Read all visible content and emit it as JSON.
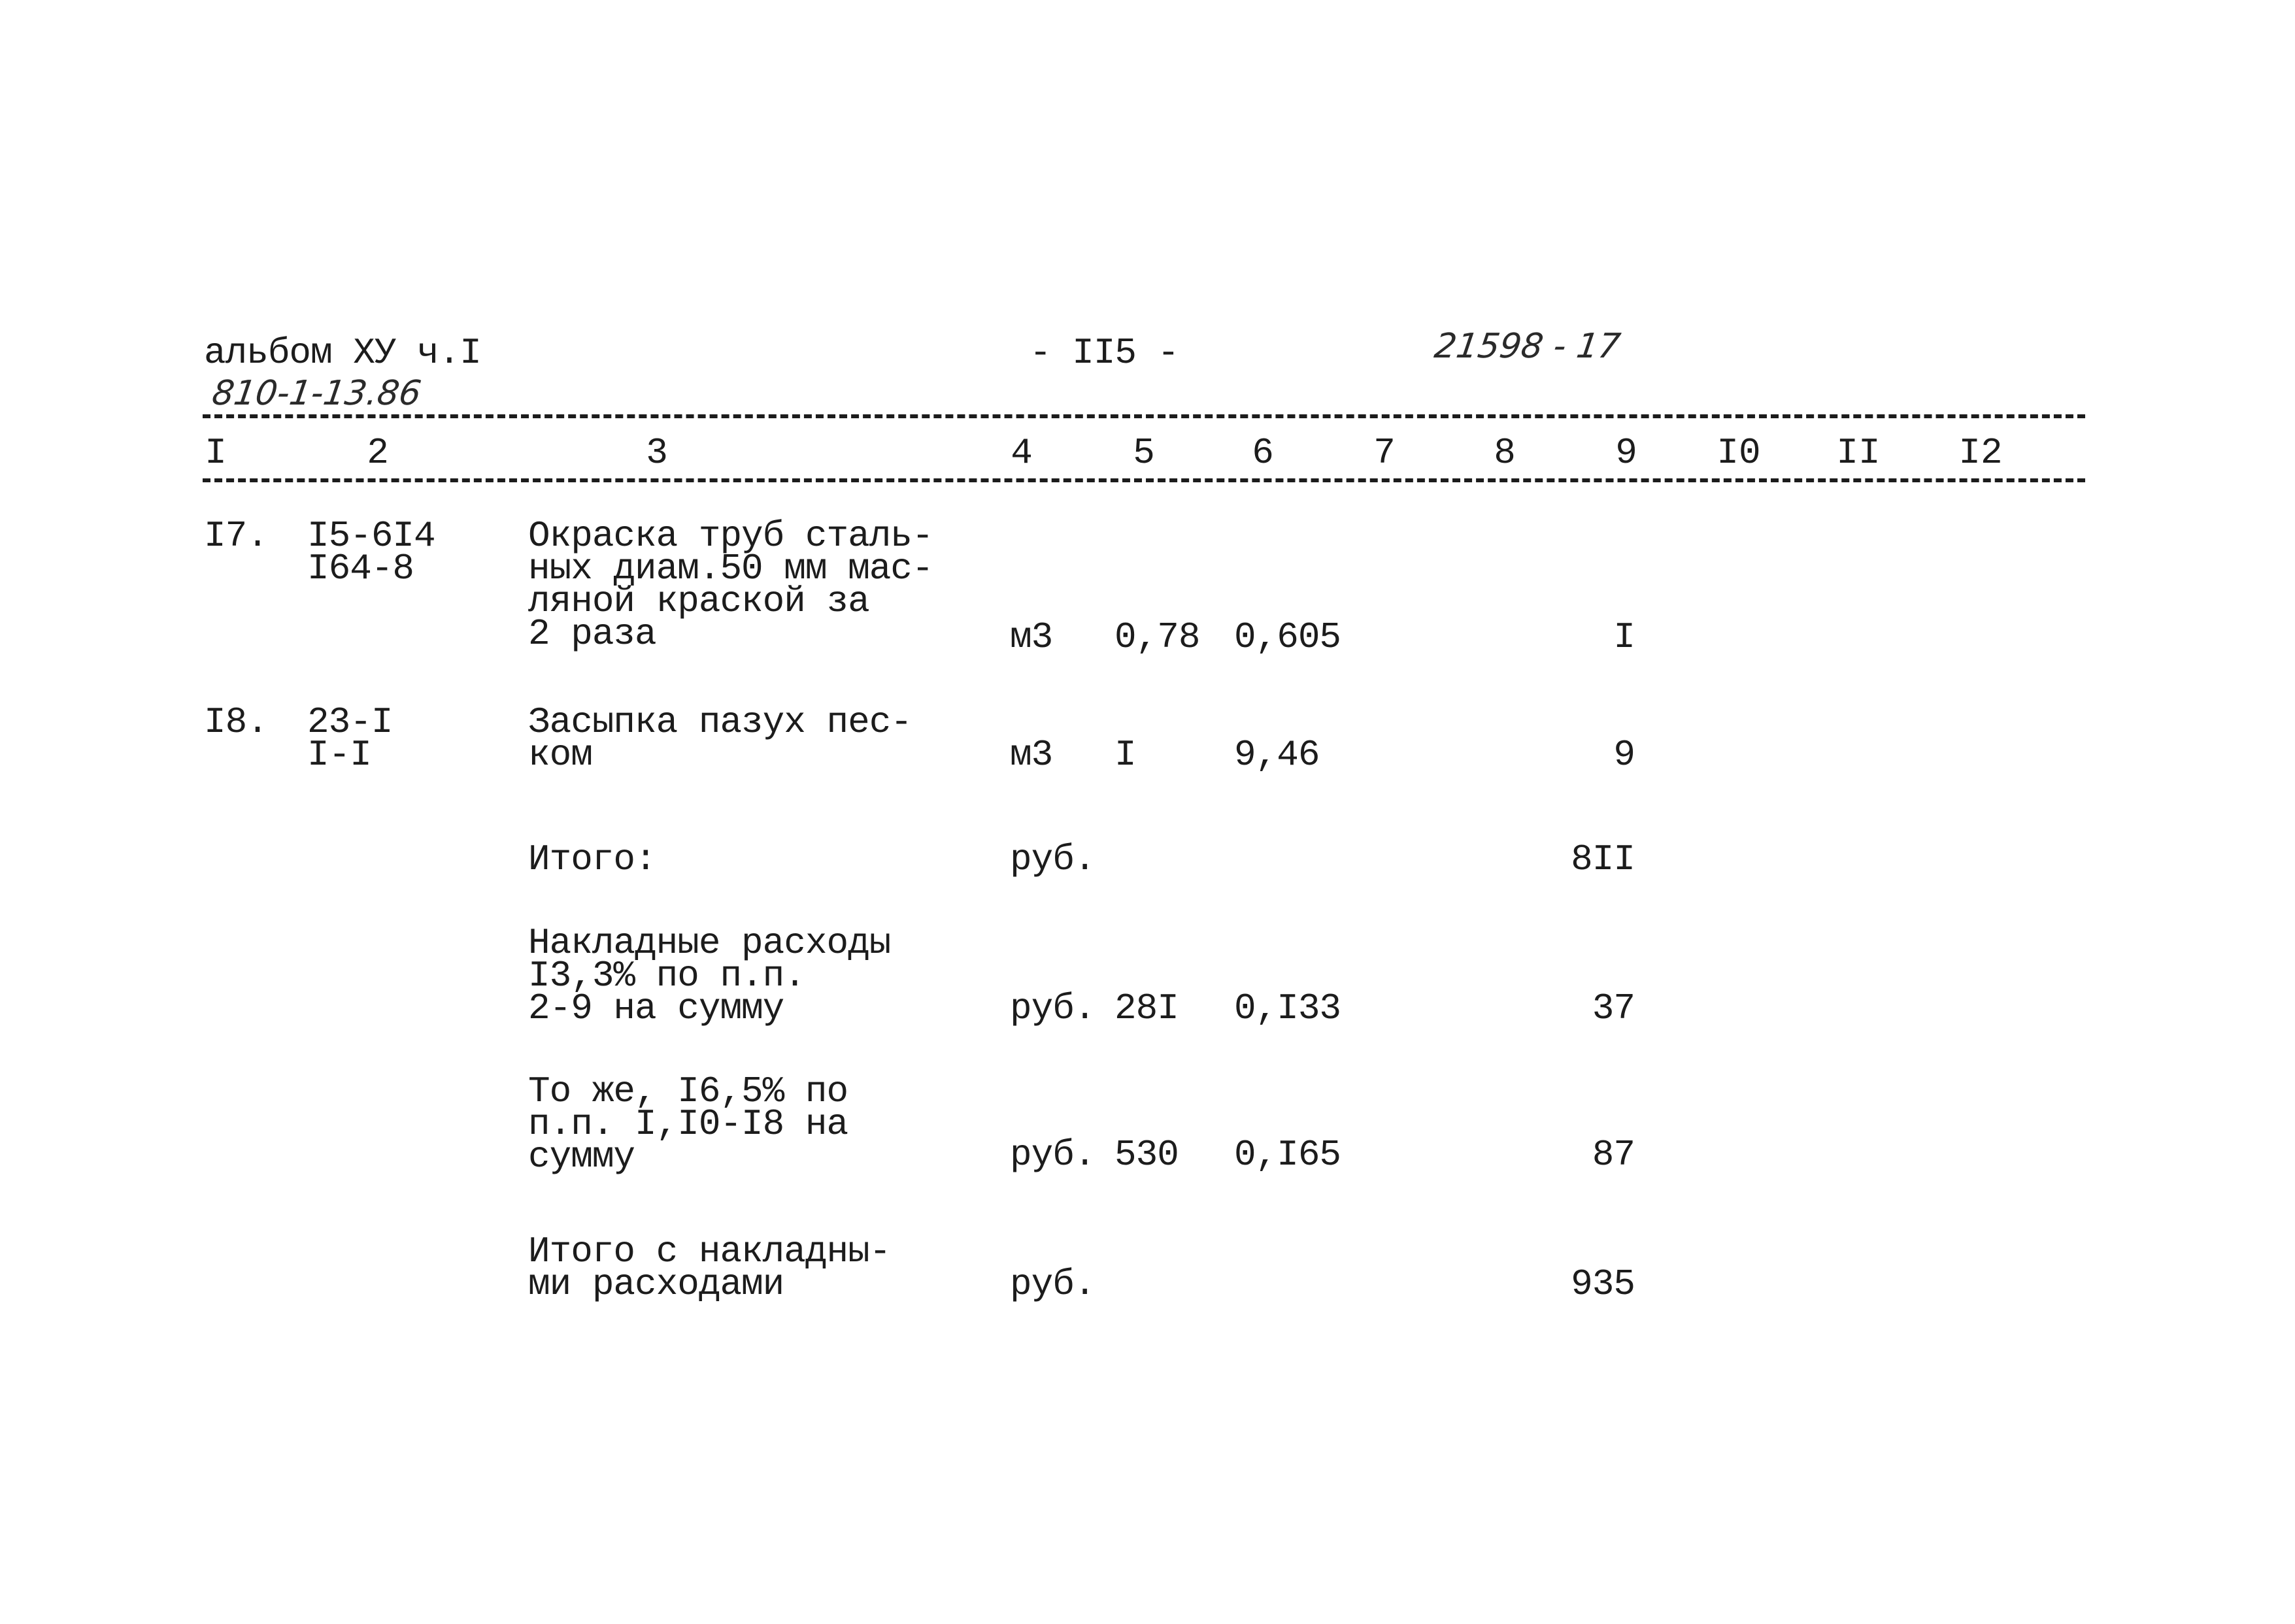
{
  "header": {
    "album": "альбом ХУ ч.I",
    "project_code_handwritten": "810-1-13.86",
    "page_number": "- II5 -",
    "archive_number_handwritten": "21598 - 17"
  },
  "columns": [
    "I",
    "2",
    "3",
    "4",
    "5",
    "6",
    "7",
    "8",
    "9",
    "I0",
    "II",
    "I2"
  ],
  "rows": [
    {
      "num": "I7.",
      "code": [
        "I5-6I4",
        "I64-8"
      ],
      "description": [
        "Окраска труб сталь-",
        "ных диам.50 мм мас-",
        "ляной краской за",
        "2 раза"
      ],
      "unit": "м3",
      "quantity": "0,78",
      "rate": "0,605",
      "total": "I"
    },
    {
      "num": "I8.",
      "code": [
        "23-I",
        "I-I"
      ],
      "description": [
        "Засыпка пазух пес-",
        "ком"
      ],
      "unit": "м3",
      "quantity": "I",
      "rate": "9,46",
      "total": "9"
    }
  ],
  "summary": [
    {
      "description": [
        "Итого:"
      ],
      "unit": "руб.",
      "quantity": "",
      "rate": "",
      "total": "8II"
    },
    {
      "description": [
        "Накладные расходы",
        "I3,3% по п.п.",
        "2-9 на сумму"
      ],
      "unit": "руб.",
      "quantity": "28I",
      "rate": "0,I33",
      "total": "37"
    },
    {
      "description": [
        "То же, I6,5% по",
        "п.п. I,I0-I8 на",
        "сумму"
      ],
      "unit": "руб.",
      "quantity": "530",
      "rate": "0,I65",
      "total": "87"
    },
    {
      "description": [
        "Итого с накладны-",
        "ми расходами"
      ],
      "unit": "руб.",
      "quantity": "",
      "rate": "",
      "total": "935"
    }
  ]
}
